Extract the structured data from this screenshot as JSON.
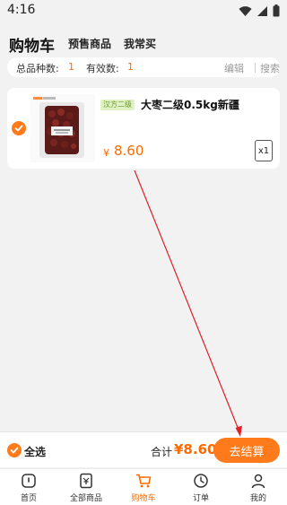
{
  "status_bar": {
    "time": "4:16"
  },
  "header": {
    "title": "购物车",
    "tabs": [
      {
        "label": "预售商品"
      },
      {
        "label": "我常买"
      }
    ]
  },
  "summary": {
    "total_kinds_label": "总品种数:",
    "total_kinds_value": "1",
    "valid_count_label": "有效数:",
    "valid_count_value": "1",
    "edit_label": "编辑",
    "search_label": "搜索"
  },
  "cart_items": [
    {
      "tag": "汉方二级",
      "name": "大枣二级0.5kg新疆",
      "price_symbol": "¥",
      "price": "8.60",
      "quantity": "x1",
      "checked": true
    }
  ],
  "action_bar": {
    "select_all_label": "全选",
    "total_label": "合计",
    "total_value": "¥8.60",
    "checkout_label": "去结算"
  },
  "tab_bar": {
    "items": [
      {
        "label": "首页",
        "icon": "home-icon",
        "active": false
      },
      {
        "label": "全部商品",
        "icon": "all-products-icon",
        "active": false
      },
      {
        "label": "购物车",
        "icon": "cart-icon",
        "active": true
      },
      {
        "label": "订单",
        "icon": "clock-icon",
        "active": false
      },
      {
        "label": "我的",
        "icon": "person-icon",
        "active": false
      }
    ]
  },
  "colors": {
    "accent": "#ff7a1a",
    "price": "#ff6a00",
    "background": "#f2f2f2",
    "arrow": "#e0202a"
  }
}
